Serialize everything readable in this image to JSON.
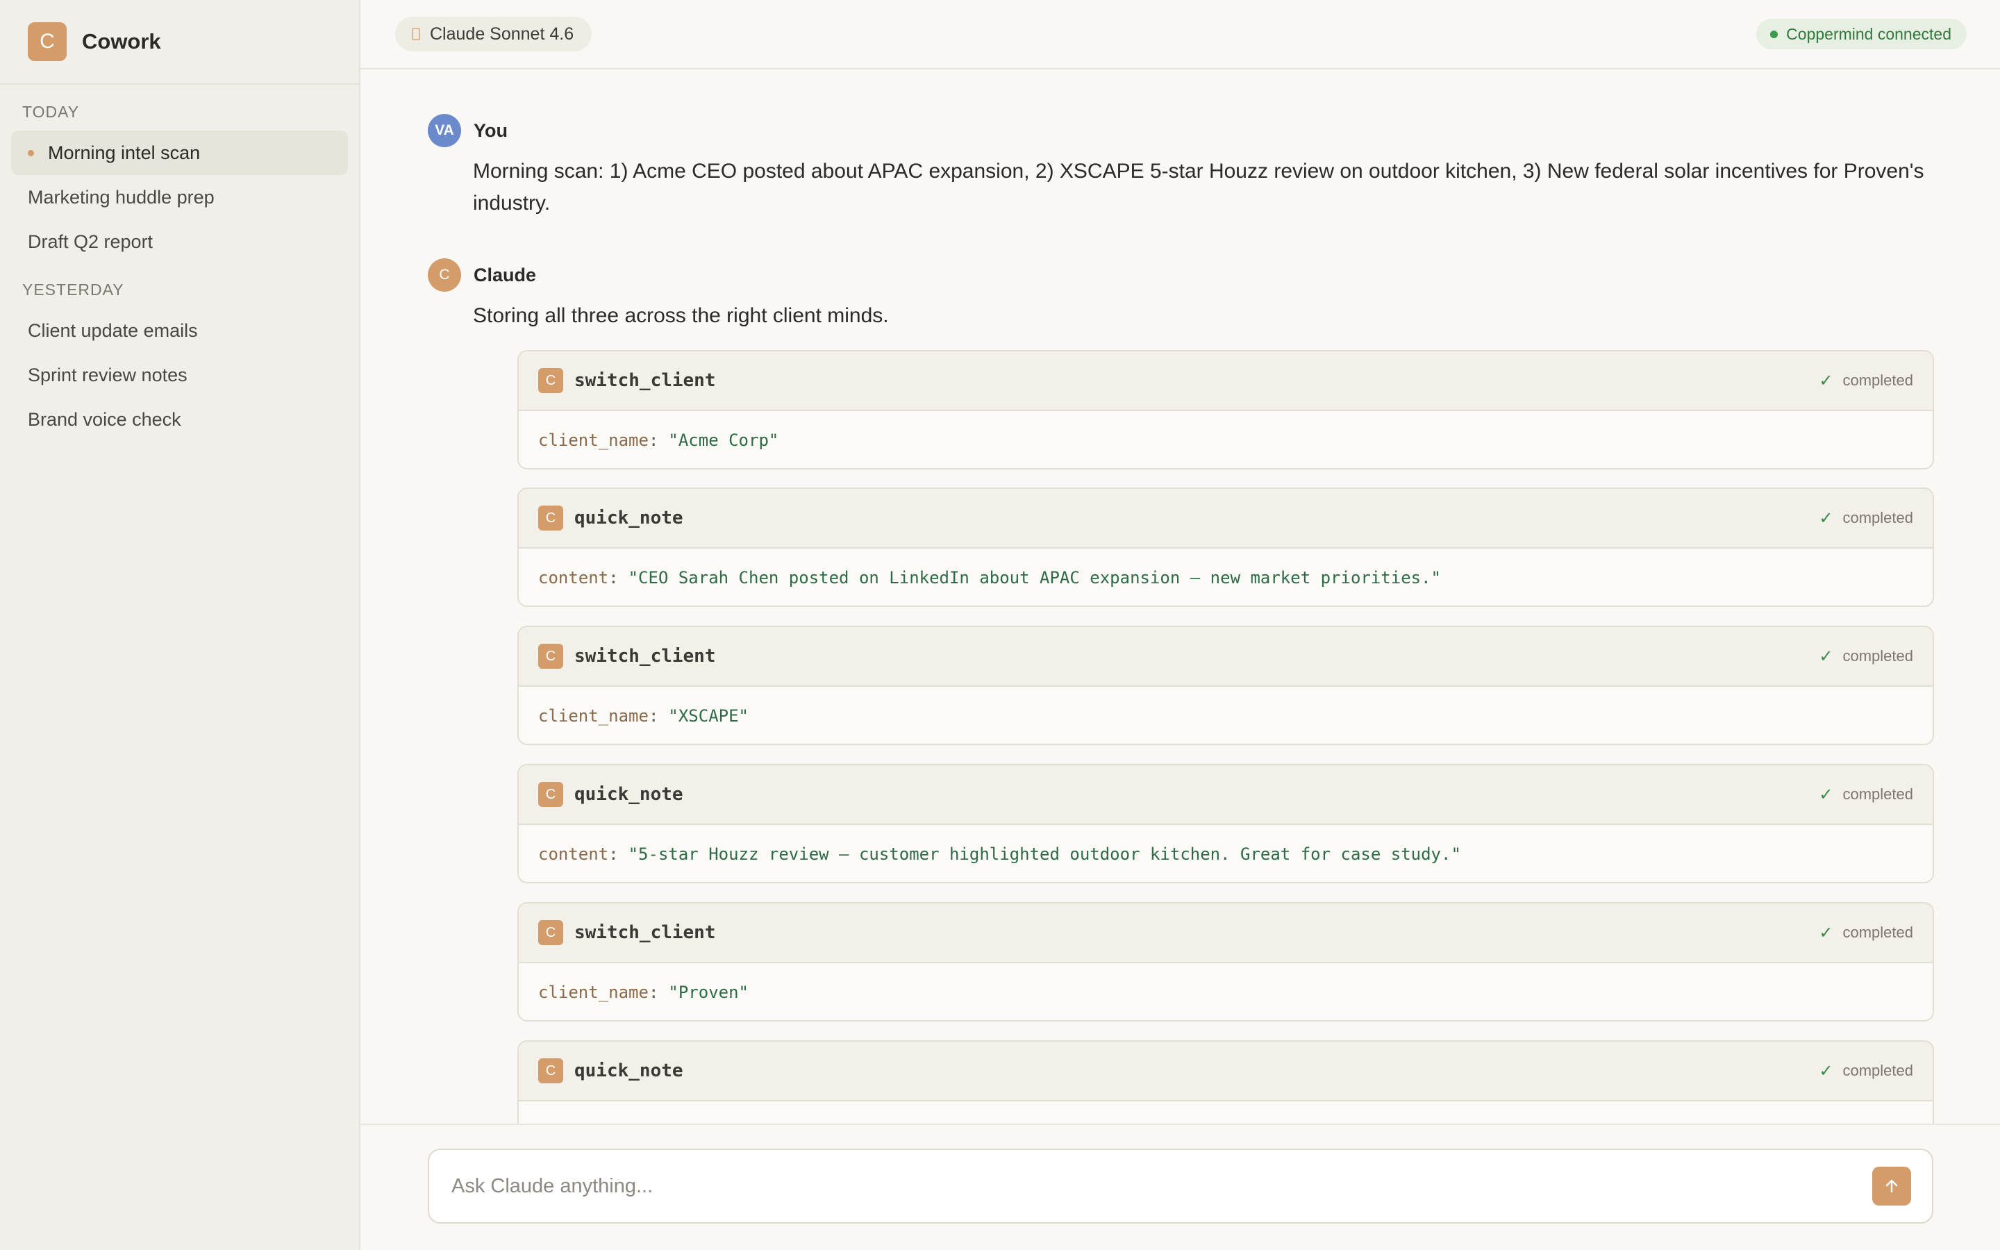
{
  "app": {
    "logo_letter": "C",
    "name": "Cowork"
  },
  "sidebar": {
    "sections": [
      {
        "title": "TODAY",
        "items": [
          "Morning intel scan",
          "Marketing huddle prep",
          "Draft Q2 report"
        ]
      },
      {
        "title": "YESTERDAY",
        "items": [
          "Client update emails",
          "Sprint review notes",
          "Brand voice check"
        ]
      }
    ],
    "active_item": "Morning intel scan"
  },
  "topbar": {
    "model_label": "Claude Sonnet 4.6",
    "connection_status": "Coppermind connected"
  },
  "conversation": {
    "user": {
      "avatar_initials": "VA",
      "name": "You",
      "text": "Morning scan: 1) Acme CEO posted about APAC expansion, 2) XSCAPE 5-star Houzz review on outdoor kitchen, 3) New federal solar incentives for Proven's industry."
    },
    "assistant": {
      "avatar_initials": "C",
      "name": "Claude",
      "text": "Storing all three across the right client minds."
    },
    "tool_calls": [
      {
        "icon": "C",
        "name": "switch_client",
        "status": "completed",
        "arg_key": "client_name",
        "arg_value": "\"Acme Corp\""
      },
      {
        "icon": "C",
        "name": "quick_note",
        "status": "completed",
        "arg_key": "content",
        "arg_value": "\"CEO Sarah Chen posted on LinkedIn about APAC expansion — new market priorities.\""
      },
      {
        "icon": "C",
        "name": "switch_client",
        "status": "completed",
        "arg_key": "client_name",
        "arg_value": "\"XSCAPE\""
      },
      {
        "icon": "C",
        "name": "quick_note",
        "status": "completed",
        "arg_key": "content",
        "arg_value": "\"5-star Houzz review — customer highlighted outdoor kitchen. Great for case study.\""
      },
      {
        "icon": "C",
        "name": "switch_client",
        "status": "completed",
        "arg_key": "client_name",
        "arg_value": "\"Proven\""
      },
      {
        "icon": "C",
        "name": "quick_note",
        "status": "completed",
        "arg_key": "",
        "arg_value": ""
      }
    ]
  },
  "composer": {
    "placeholder": "Ask Claude anything...",
    "send_icon": "arrow-up-icon"
  },
  "colors": {
    "accent": "#d39c69",
    "user_avatar": "#6b8acb",
    "success": "#3b9a4b"
  }
}
